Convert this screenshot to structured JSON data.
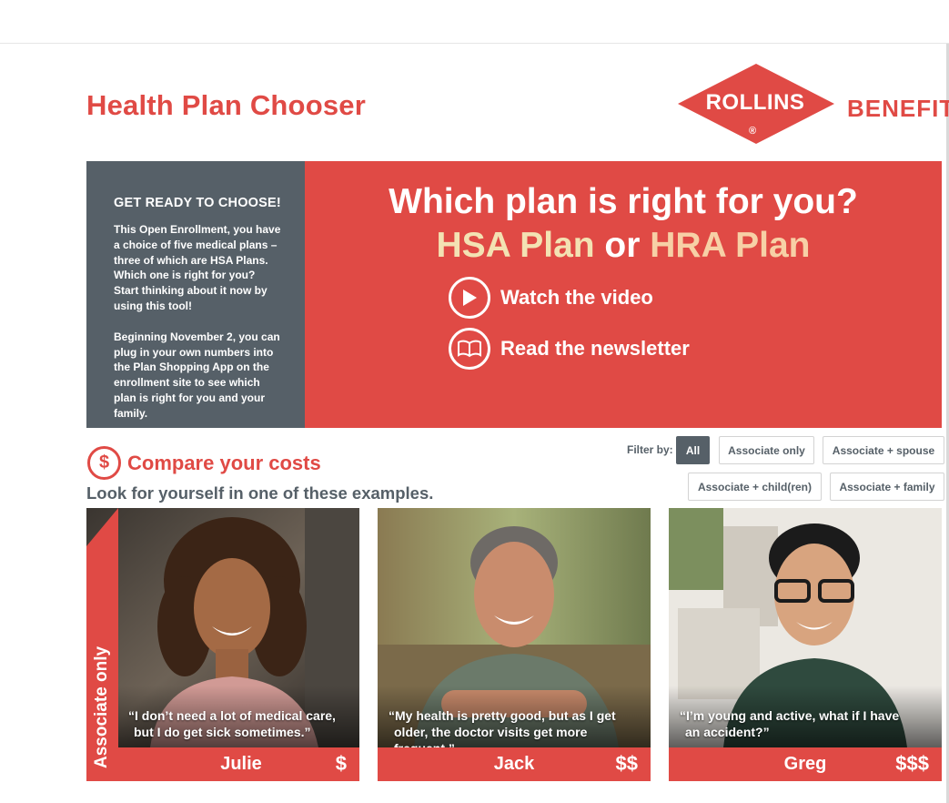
{
  "header": {
    "app_title": "Health Plan Chooser",
    "logo_word": "ROLLINS",
    "logo_reg": "®",
    "logo_benefits": "BENEFITS",
    "brand_color": "#e04a45",
    "slate_color": "#566068"
  },
  "sidebar": {
    "heading": "GET READY TO CHOOSE!",
    "paragraph1": "This Open Enrollment, you have a choice of five medical plans – three of which are HSA Plans. Which one is right for you? Start thinking about it now by using this tool!",
    "paragraph2": "Beginning November 2, you can plug in your own numbers into the Plan Shopping App on the enrollment site to see which plan is right for you and your family."
  },
  "hero": {
    "question": "Which plan is right for you?",
    "plan_a": "HSA Plan",
    "connector": " or ",
    "plan_b": "HRA Plan",
    "video_label": "Watch the video",
    "video_icon": "play-icon",
    "newsletter_label": "Read the newsletter",
    "newsletter_icon": "book-icon"
  },
  "compare": {
    "icon": "dollar-icon",
    "icon_glyph": "$",
    "title": "Compare your costs",
    "subtitle": "Look for yourself in one of these examples."
  },
  "filter": {
    "label": "Filter by:",
    "options": [
      "All",
      "Associate only",
      "Associate + spouse",
      "Associate + child(ren)",
      "Associate + family"
    ],
    "selected": "All"
  },
  "ribbon": {
    "label": "Associate only"
  },
  "cards": [
    {
      "name": "Julie",
      "cost": "$",
      "quote_line1": "“I don’t need a lot of medical care,",
      "quote_line2": "but I do get sick sometimes.”"
    },
    {
      "name": "Jack",
      "cost": "$$",
      "quote_line1": "“My health is pretty good, but as I get",
      "quote_line2": "older, the doctor visits get more frequent.”"
    },
    {
      "name": "Greg",
      "cost": "$$$",
      "quote_line1": "“I’m young and active, what if I have",
      "quote_line2": "an accident?”"
    }
  ]
}
